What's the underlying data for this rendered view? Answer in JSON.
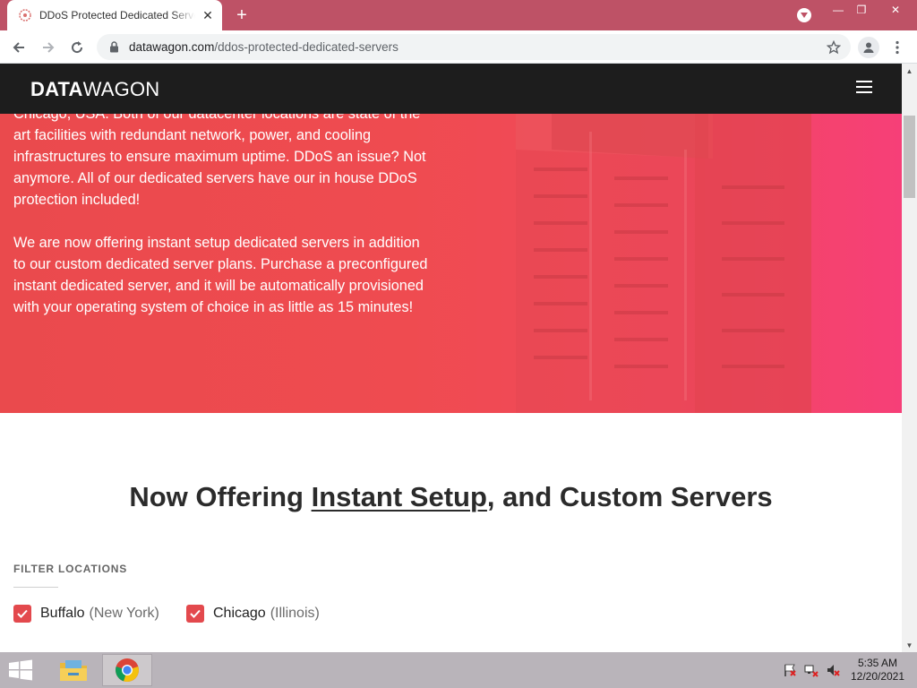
{
  "browser": {
    "tab_title": "DDoS Protected Dedicated Servers",
    "url_domain": "datawagon.com",
    "url_path": "/ddos-protected-dedicated-servers"
  },
  "site": {
    "logo_bold": "DATA",
    "logo_light": "WAGON"
  },
  "hero": {
    "paragraph1": "Chicago, USA. Both of our datacenter locations are state of the art facilities with redundant network, power, and cooling infrastructures to ensure maximum uptime. DDoS an issue? Not anymore. All of our dedicated servers have our in house DDoS protection included!",
    "paragraph2": "We are now offering instant setup dedicated servers in addition to our custom dedicated server plans. Purchase a preconfigured instant dedicated server, and it will be automatically provisioned with your operating system of choice in as little as 15 minutes!"
  },
  "section": {
    "headline_prefix": "Now Offering ",
    "headline_link": "Instant Setup",
    "headline_suffix": ", and Custom Servers",
    "filter_label": "FILTER LOCATIONS"
  },
  "locations": [
    {
      "city": "Buffalo",
      "state": "(New York)",
      "checked": true
    },
    {
      "city": "Chicago",
      "state": "(Illinois)",
      "checked": true
    }
  ],
  "taskbar": {
    "time": "5:35 AM",
    "date": "12/20/2021"
  },
  "colors": {
    "accent": "#e3494d",
    "header": "#1d1d1d",
    "tabbar": "#be5266"
  }
}
